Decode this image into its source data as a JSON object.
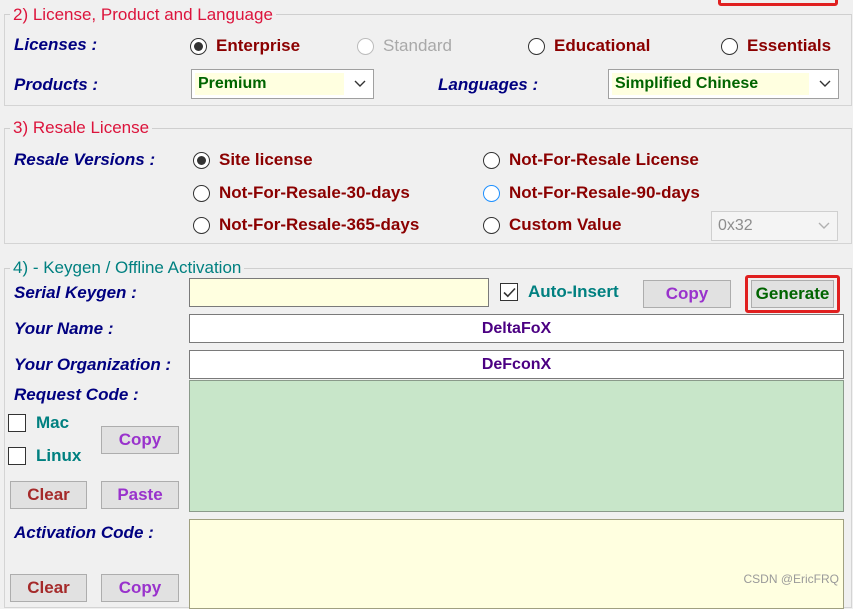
{
  "section2": {
    "title": "2) License, Product and Language",
    "licenses_label": "Licenses :",
    "licenses": [
      {
        "label": "Enterprise",
        "checked": true,
        "disabled": false
      },
      {
        "label": "Standard",
        "checked": false,
        "disabled": true
      },
      {
        "label": "Educational",
        "checked": false,
        "disabled": false
      },
      {
        "label": "Essentials",
        "checked": false,
        "disabled": false
      }
    ],
    "products_label": "Products :",
    "products_value": "Premium",
    "languages_label": "Languages :",
    "languages_value": "Simplified Chinese"
  },
  "section3": {
    "title": "3) Resale License",
    "resale_label": "Resale Versions :",
    "options": [
      {
        "label": "Site license",
        "checked": true
      },
      {
        "label": "Not-For-Resale License",
        "checked": false
      },
      {
        "label": "Not-For-Resale-30-days",
        "checked": false
      },
      {
        "label": "Not-For-Resale-90-days",
        "checked": false,
        "focused": true
      },
      {
        "label": "Not-For-Resale-365-days",
        "checked": false
      },
      {
        "label": "Custom Value",
        "checked": false
      }
    ],
    "custom_value": "0x32"
  },
  "section4": {
    "title": "4) - Keygen / Offline Activation",
    "serial_label": "Serial Keygen :",
    "serial_value": "",
    "auto_insert_label": "Auto-Insert",
    "auto_insert_checked": true,
    "copy_label": "Copy",
    "generate_label": "Generate",
    "name_label": "Your Name :",
    "name_value": "DeltaFoX",
    "org_label": "Your Organization :",
    "org_value": "DeFconX",
    "request_label": "Request Code :",
    "mac_label": "Mac",
    "linux_label": "Linux",
    "request_copy_label": "Copy",
    "clear_label": "Clear",
    "paste_label": "Paste",
    "activation_label": "Activation Code :",
    "activation_clear_label": "Clear",
    "activation_copy_label": "Copy"
  },
  "colors": {
    "title_red": "#dc143c",
    "label_navy": "#000080",
    "request_green": "#c8e6c9",
    "activation_yellow": "#ffffe0",
    "highlight_red": "#e02020"
  },
  "watermark": "CSDN @EricFRQ"
}
